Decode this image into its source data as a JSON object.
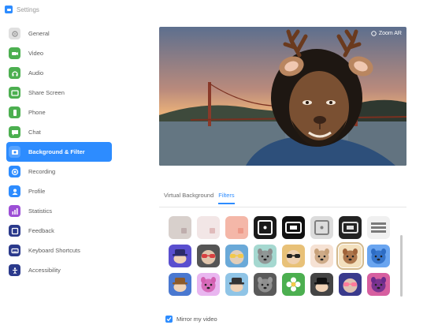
{
  "window": {
    "title": "Settings"
  },
  "sidebar": {
    "items": [
      {
        "label": "General",
        "icon": "gear-icon",
        "color": "#e0e0e0",
        "active": false
      },
      {
        "label": "Video",
        "icon": "video-icon",
        "color": "#4caf50",
        "active": false
      },
      {
        "label": "Audio",
        "icon": "headphones-icon",
        "color": "#4caf50",
        "active": false
      },
      {
        "label": "Share Screen",
        "icon": "share-screen-icon",
        "color": "#4caf50",
        "active": false
      },
      {
        "label": "Phone",
        "icon": "phone-icon",
        "color": "#4caf50",
        "active": false
      },
      {
        "label": "Chat",
        "icon": "chat-bubble-icon",
        "color": "#4caf50",
        "active": false
      },
      {
        "label": "Background & Filter",
        "icon": "background-filter-icon",
        "color": "#2d8cff",
        "active": true
      },
      {
        "label": "Recording",
        "icon": "record-icon",
        "color": "#2d8cff",
        "active": false
      },
      {
        "label": "Profile",
        "icon": "profile-icon",
        "color": "#2d8cff",
        "active": false
      },
      {
        "label": "Statistics",
        "icon": "statistics-icon",
        "color": "#9c4fd6",
        "active": false
      },
      {
        "label": "Feedback",
        "icon": "feedback-icon",
        "color": "#2b3a8c",
        "active": false
      },
      {
        "label": "Keyboard Shortcuts",
        "icon": "keyboard-icon",
        "color": "#2b3a8c",
        "active": false
      },
      {
        "label": "Accessibility",
        "icon": "accessibility-icon",
        "color": "#2b3a8c",
        "active": false
      }
    ]
  },
  "preview": {
    "badge": "Zoom AR"
  },
  "tabs": [
    {
      "label": "Virtual Background",
      "active": false
    },
    {
      "label": "Filters",
      "active": true
    }
  ],
  "filters": [
    {
      "name": "none",
      "bg": "#d8d0cc",
      "fg": "#b59f9f",
      "kind": "plain"
    },
    {
      "name": "soft-pink",
      "bg": "#f2e6e6",
      "fg": "#d9a8a8",
      "kind": "plain"
    },
    {
      "name": "peach",
      "bg": "#f4b7a8",
      "fg": "#e98c7a",
      "kind": "plain"
    },
    {
      "name": "dark-frame",
      "bg": "#1a1a1a",
      "fg": "#ffffff",
      "kind": "frame"
    },
    {
      "name": "tv-frame",
      "bg": "#111111",
      "fg": "#ffffff",
      "kind": "tv"
    },
    {
      "name": "retro-frame",
      "bg": "#dcdcdc",
      "fg": "#808080",
      "kind": "frame"
    },
    {
      "name": "film-frame",
      "bg": "#222222",
      "fg": "#dddddd",
      "kind": "tv"
    },
    {
      "name": "stripes",
      "bg": "#f0f0f0",
      "fg": "#7a7a7a",
      "kind": "stripes"
    },
    {
      "name": "purple-hat",
      "bg": "#5a4fcf",
      "fg": "#2b2b6b",
      "kind": "hat"
    },
    {
      "name": "red-glasses",
      "bg": "#555555",
      "fg": "#d94040",
      "kind": "glasses"
    },
    {
      "name": "yellow-goggles",
      "bg": "#6aa9d8",
      "fg": "#f2c94c",
      "kind": "glasses"
    },
    {
      "name": "koala",
      "bg": "#a5d8d0",
      "fg": "#8c8c8c",
      "kind": "face"
    },
    {
      "name": "sunglasses",
      "bg": "#e8c178",
      "fg": "#222222",
      "kind": "glasses"
    },
    {
      "name": "cat-ears",
      "bg": "#f6e2d4",
      "fg": "#c7a17a",
      "kind": "face"
    },
    {
      "name": "deer",
      "bg": "#f3e0bd",
      "fg": "#a0643a",
      "kind": "face"
    },
    {
      "name": "blue-bear",
      "bg": "#6aa5f0",
      "fg": "#2d6cc4",
      "kind": "face"
    },
    {
      "name": "cowboy",
      "bg": "#4a78d0",
      "fg": "#8c5a2b",
      "kind": "hat"
    },
    {
      "name": "pink-bunny",
      "bg": "#e9b6f0",
      "fg": "#d45fb0",
      "kind": "face"
    },
    {
      "name": "top-hat",
      "bg": "#8fc4e6",
      "fg": "#333333",
      "kind": "hat"
    },
    {
      "name": "dark-face",
      "bg": "#5a5a5a",
      "fg": "#999999",
      "kind": "face"
    },
    {
      "name": "flower",
      "bg": "#4caf50",
      "fg": "#ffffff",
      "kind": "flower"
    },
    {
      "name": "detective",
      "bg": "#444444",
      "fg": "#111111",
      "kind": "hat"
    },
    {
      "name": "night-mask",
      "bg": "#3a3a8c",
      "fg": "#ff7a9a",
      "kind": "glasses"
    },
    {
      "name": "alien",
      "bg": "#d75fa0",
      "fg": "#6a2b8c",
      "kind": "face"
    }
  ],
  "selected_filter": 14,
  "mirror": {
    "label": "Mirror my video",
    "checked": true
  }
}
